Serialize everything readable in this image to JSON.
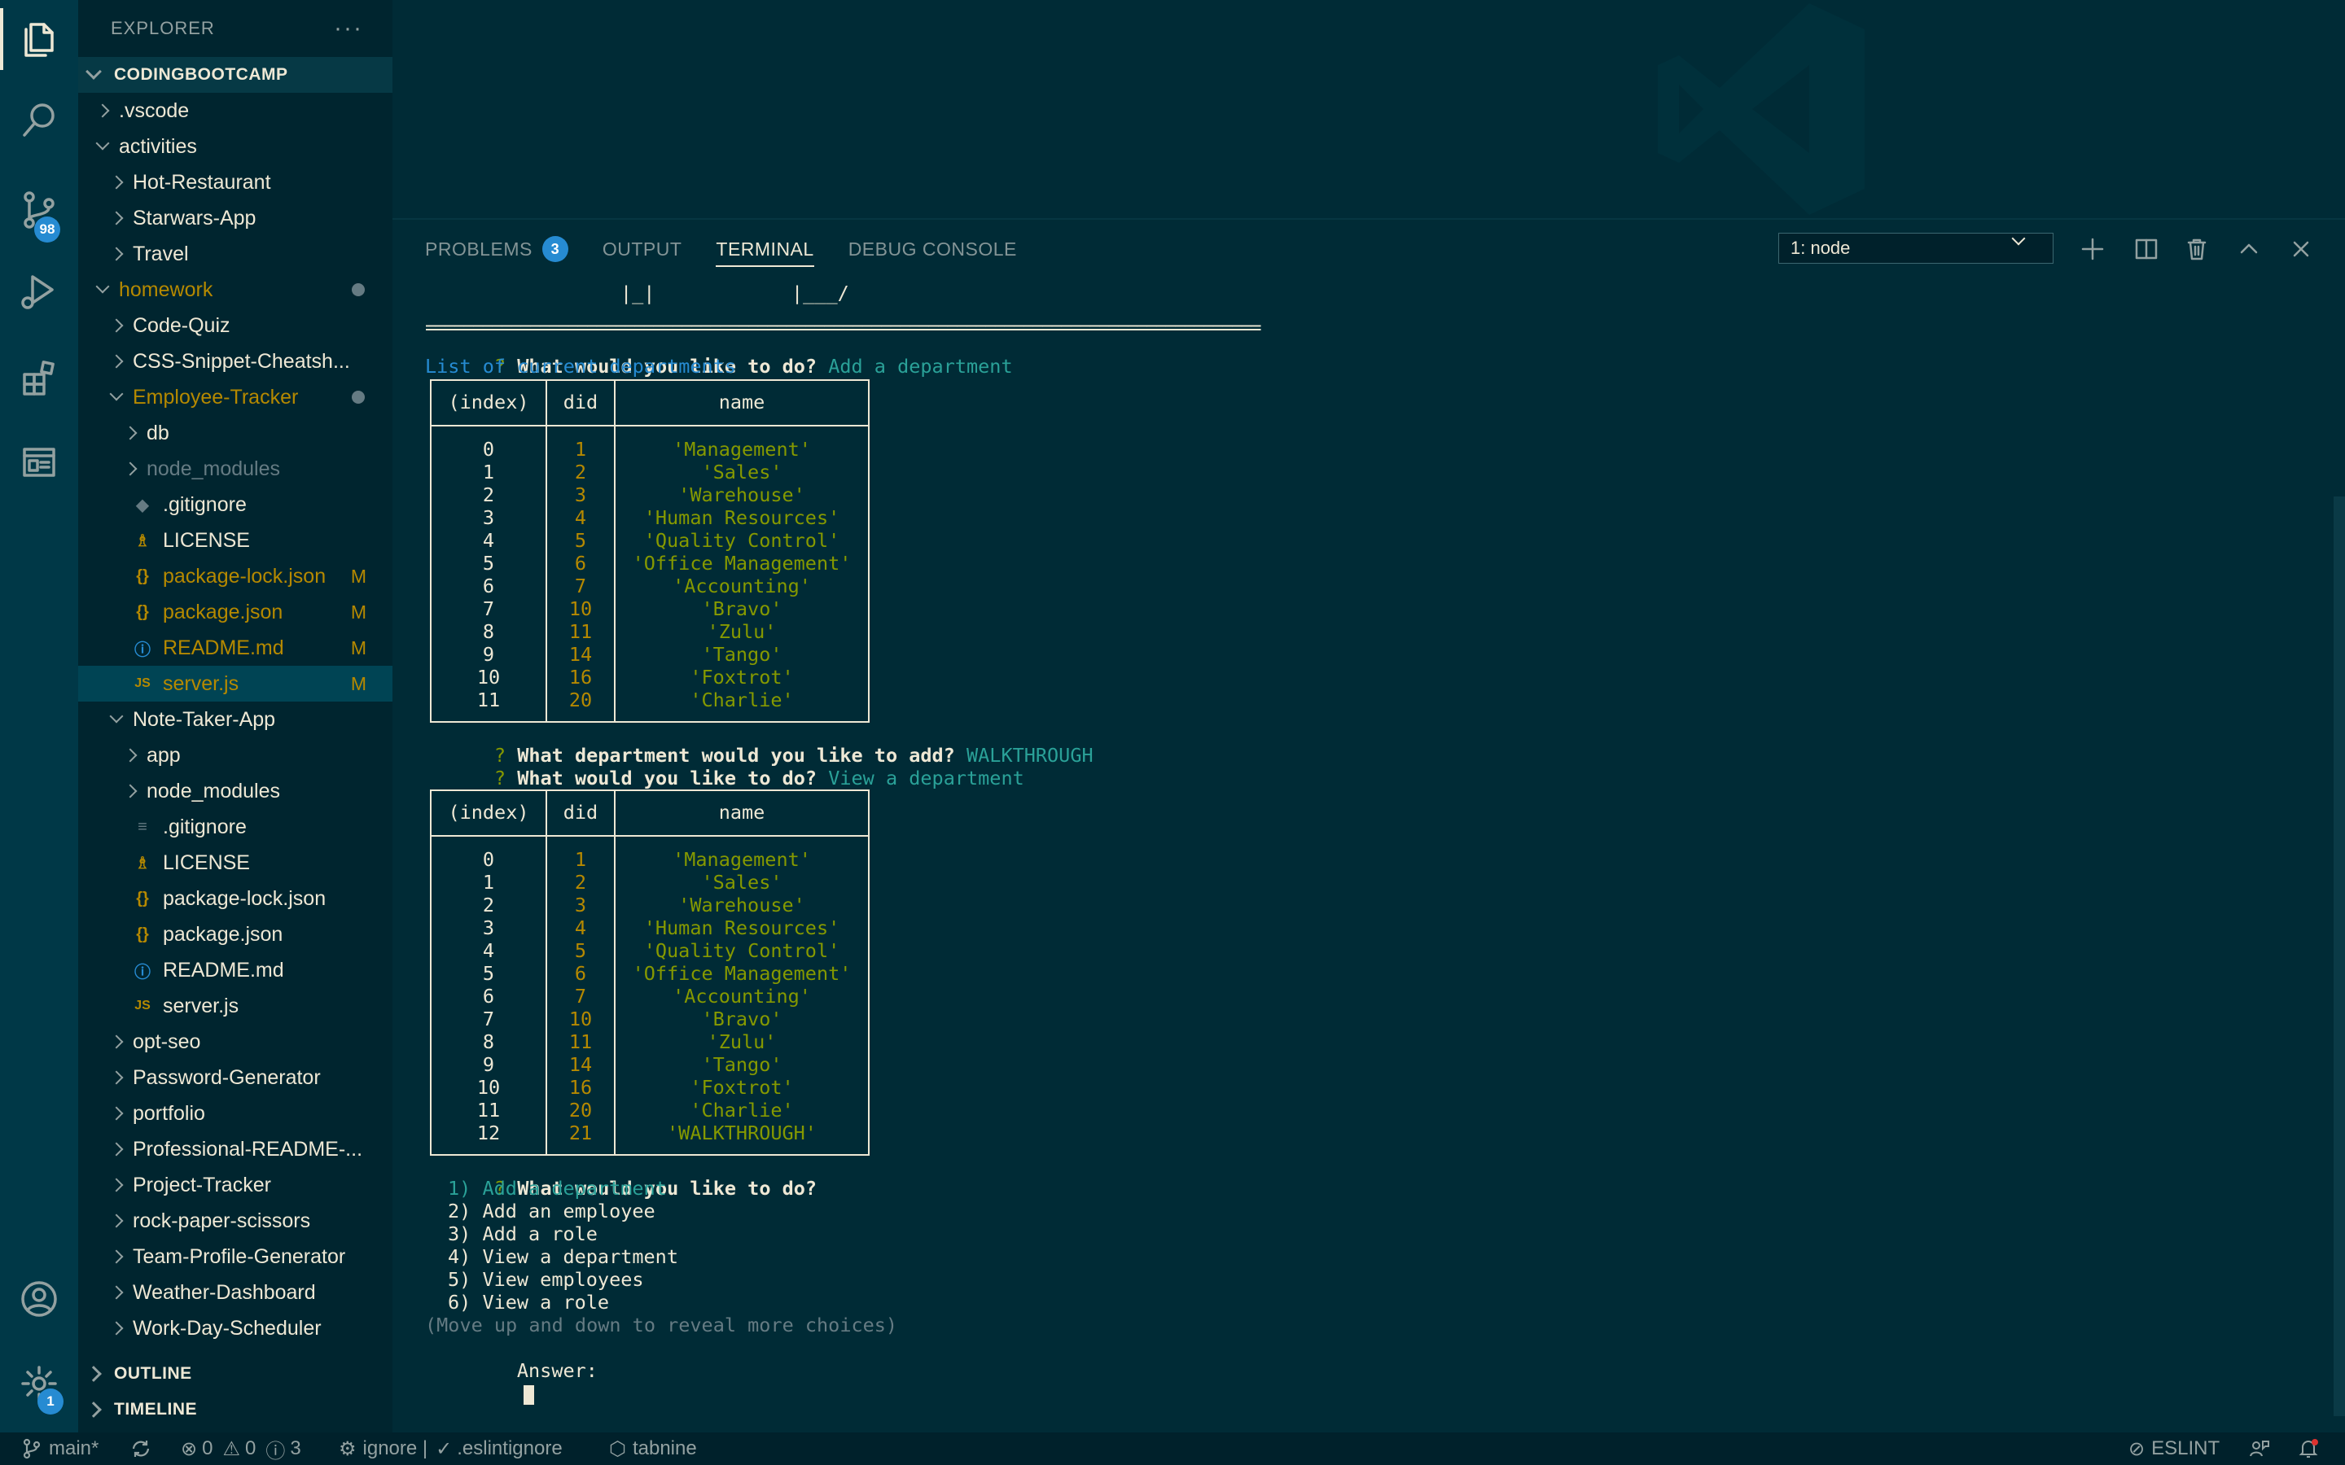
{
  "activity_bar": {
    "items": [
      {
        "name": "explorer-icon",
        "active": true
      },
      {
        "name": "search-icon"
      },
      {
        "name": "source-control-icon",
        "badge": "98"
      },
      {
        "name": "run-debug-icon"
      },
      {
        "name": "extensions-icon"
      },
      {
        "name": "remote-explorer-icon"
      }
    ],
    "account_icon": "account-icon",
    "settings_icon": "gear-icon",
    "settings_badge": "1"
  },
  "sidebar": {
    "title": "EXPLORER",
    "more": "···",
    "root": "CODINGBOOTCAMP",
    "tree": [
      {
        "label": ".vscode",
        "depth": 1,
        "type": "folder",
        "open": false
      },
      {
        "label": "activities",
        "depth": 1,
        "type": "folder",
        "open": true
      },
      {
        "label": "Hot-Restaurant",
        "depth": 2,
        "type": "folder",
        "open": false
      },
      {
        "label": "Starwars-App",
        "depth": 2,
        "type": "folder",
        "open": false
      },
      {
        "label": "Travel",
        "depth": 2,
        "type": "folder",
        "open": false
      },
      {
        "label": "homework",
        "depth": 1,
        "type": "folder",
        "open": true,
        "modified": true,
        "dot": true
      },
      {
        "label": "Code-Quiz",
        "depth": 2,
        "type": "folder",
        "open": false
      },
      {
        "label": "CSS-Snippet-Cheatsh...",
        "depth": 2,
        "type": "folder",
        "open": false
      },
      {
        "label": "Employee-Tracker",
        "depth": 2,
        "type": "folder",
        "open": true,
        "modified": true,
        "dot": true
      },
      {
        "label": "db",
        "depth": 3,
        "type": "folder",
        "open": false
      },
      {
        "label": "node_modules",
        "depth": 3,
        "type": "folder",
        "open": false,
        "dim": true
      },
      {
        "label": ".gitignore",
        "depth": 3,
        "type": "file",
        "icon": "◆",
        "dim_icon": true
      },
      {
        "label": "LICENSE",
        "depth": 3,
        "type": "file",
        "icon": "♗"
      },
      {
        "label": "package-lock.json",
        "depth": 3,
        "type": "file",
        "icon": "{}",
        "modified": true,
        "flag": "M"
      },
      {
        "label": "package.json",
        "depth": 3,
        "type": "file",
        "icon": "{}",
        "modified": true,
        "flag": "M"
      },
      {
        "label": "README.md",
        "depth": 3,
        "type": "file",
        "icon": "ⓘ",
        "modified": true,
        "flag": "M"
      },
      {
        "label": "server.js",
        "depth": 3,
        "type": "file",
        "icon": "JS",
        "modified": true,
        "flag": "M",
        "selected": true
      },
      {
        "label": "Note-Taker-App",
        "depth": 2,
        "type": "folder",
        "open": true
      },
      {
        "label": "app",
        "depth": 3,
        "type": "folder",
        "open": false
      },
      {
        "label": "node_modules",
        "depth": 3,
        "type": "folder",
        "open": false
      },
      {
        "label": ".gitignore",
        "depth": 3,
        "type": "file",
        "icon": "≡"
      },
      {
        "label": "LICENSE",
        "depth": 3,
        "type": "file",
        "icon": "♗"
      },
      {
        "label": "package-lock.json",
        "depth": 3,
        "type": "file",
        "icon": "{}"
      },
      {
        "label": "package.json",
        "depth": 3,
        "type": "file",
        "icon": "{}"
      },
      {
        "label": "README.md",
        "depth": 3,
        "type": "file",
        "icon": "ⓘ"
      },
      {
        "label": "server.js",
        "depth": 3,
        "type": "file",
        "icon": "JS"
      },
      {
        "label": "opt-seo",
        "depth": 2,
        "type": "folder",
        "open": false
      },
      {
        "label": "Password-Generator",
        "depth": 2,
        "type": "folder",
        "open": false
      },
      {
        "label": "portfolio",
        "depth": 2,
        "type": "folder",
        "open": false
      },
      {
        "label": "Professional-README-...",
        "depth": 2,
        "type": "folder",
        "open": false
      },
      {
        "label": "Project-Tracker",
        "depth": 2,
        "type": "folder",
        "open": false
      },
      {
        "label": "rock-paper-scissors",
        "depth": 2,
        "type": "folder",
        "open": false
      },
      {
        "label": "Team-Profile-Generator",
        "depth": 2,
        "type": "folder",
        "open": false
      },
      {
        "label": "Weather-Dashboard",
        "depth": 2,
        "type": "folder",
        "open": false
      },
      {
        "label": "Work-Day-Scheduler",
        "depth": 2,
        "type": "folder",
        "open": false
      }
    ],
    "outline": "OUTLINE",
    "timeline": "TIMELINE"
  },
  "panel": {
    "tabs": [
      {
        "label": "PROBLEMS",
        "count": "3"
      },
      {
        "label": "OUTPUT"
      },
      {
        "label": "TERMINAL",
        "active": true
      },
      {
        "label": "DEBUG CONSOLE"
      }
    ],
    "terminal_select": "1: node",
    "actions": [
      "add-terminal-icon",
      "split-terminal-icon",
      "trash-icon",
      "maximize-icon",
      "close-icon"
    ]
  },
  "terminal": {
    "ascii_fragment_1": "|_|",
    "ascii_fragment_2": "|___/",
    "separator": "========================================================================================",
    "q1_mark": "?",
    "q1_text": "What would you like to do?",
    "q1_answer": "Add a department",
    "list_heading": "List of current departments",
    "table_headers": [
      "(index)",
      "did",
      "name"
    ],
    "table1": [
      [
        "0",
        "1",
        "'Management'"
      ],
      [
        "1",
        "2",
        "'Sales'"
      ],
      [
        "2",
        "3",
        "'Warehouse'"
      ],
      [
        "3",
        "4",
        "'Human Resources'"
      ],
      [
        "4",
        "5",
        "'Quality Control'"
      ],
      [
        "5",
        "6",
        "'Office Management'"
      ],
      [
        "6",
        "7",
        "'Accounting'"
      ],
      [
        "7",
        "10",
        "'Bravo'"
      ],
      [
        "8",
        "11",
        "'Zulu'"
      ],
      [
        "9",
        "14",
        "'Tango'"
      ],
      [
        "10",
        "16",
        "'Foxtrot'"
      ],
      [
        "11",
        "20",
        "'Charlie'"
      ]
    ],
    "q2_mark": "?",
    "q2_text": "What department would you like to add?",
    "q2_answer": "WALKTHROUGH",
    "q3_mark": "?",
    "q3_text": "What would you like to do?",
    "q3_answer": "View a department",
    "table2": [
      [
        "0",
        "1",
        "'Management'"
      ],
      [
        "1",
        "2",
        "'Sales'"
      ],
      [
        "2",
        "3",
        "'Warehouse'"
      ],
      [
        "3",
        "4",
        "'Human Resources'"
      ],
      [
        "4",
        "5",
        "'Quality Control'"
      ],
      [
        "5",
        "6",
        "'Office Management'"
      ],
      [
        "6",
        "7",
        "'Accounting'"
      ],
      [
        "7",
        "10",
        "'Bravo'"
      ],
      [
        "8",
        "11",
        "'Zulu'"
      ],
      [
        "9",
        "14",
        "'Tango'"
      ],
      [
        "10",
        "16",
        "'Foxtrot'"
      ],
      [
        "11",
        "20",
        "'Charlie'"
      ],
      [
        "12",
        "21",
        "'WALKTHROUGH'"
      ]
    ],
    "q4_mark": "?",
    "q4_text": "What would you like to do?",
    "choices": [
      "1) Add a department",
      "2) Add an employee",
      "3) Add a role",
      "4) View a department",
      "5) View employees",
      "6) View a role"
    ],
    "hint": "(Move up and down to reveal more choices)",
    "answer_label": "Answer:"
  },
  "statusbar": {
    "branch": "main*",
    "errors": "0",
    "warnings": "0",
    "infos": "3",
    "ignore": "ignore |",
    "eslintignore": ".eslintignore",
    "tabnine": "tabnine",
    "eslint": "ESLINT"
  }
}
